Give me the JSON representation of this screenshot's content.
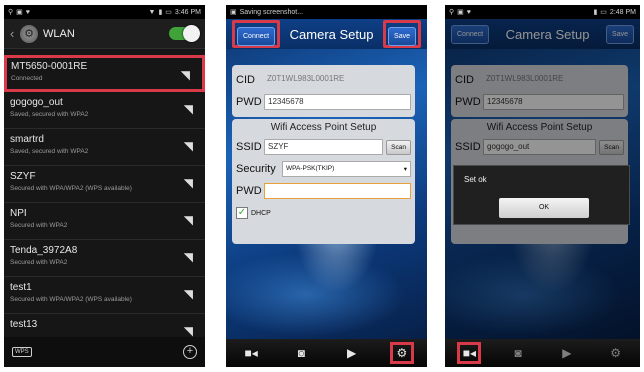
{
  "phone1": {
    "status_time": "3:46 PM",
    "title": "WLAN",
    "networks": [
      {
        "ssid": "MT5650-0001RE",
        "status": "Connected"
      },
      {
        "ssid": "gogogo_out",
        "status": "Saved, secured with WPA2"
      },
      {
        "ssid": "smartrd",
        "status": "Saved, secured with WPA2"
      },
      {
        "ssid": "SZYF",
        "status": "Secured with WPA/WPA2 (WPS available)"
      },
      {
        "ssid": "NPI",
        "status": "Secured with WPA2"
      },
      {
        "ssid": "Tenda_3972A8",
        "status": "Secured with WPA2"
      },
      {
        "ssid": "test1",
        "status": "Secured with WPA/WPA2 (WPS available)"
      },
      {
        "ssid": "test13",
        "status": ""
      }
    ],
    "wps_label": "WPS"
  },
  "phone2": {
    "status_text": "Saving screenshot...",
    "connect_label": "Connect",
    "title": "Camera Setup",
    "save_label": "Save",
    "cid_label": "CID",
    "cid_value": "Z0T1WL983L0001RE",
    "pwd_label": "PWD",
    "pwd_value": "12345678",
    "wifi_title": "Wifi Access Point Setup",
    "ssid_label": "SSID",
    "ssid_value": "SZYF",
    "scan_label": "Scan",
    "security_label": "Security",
    "security_value": "WPA-PSK(TKIP)",
    "wifi_pwd_label": "PWD",
    "dhcp_label": "DHCP"
  },
  "phone3": {
    "status_time": "2:48 PM",
    "connect_label": "Connect",
    "title": "Camera Setup",
    "save_label": "Save",
    "cid_label": "CID",
    "cid_value": "Z0T1WL983L0001RE",
    "pwd_label": "PWD",
    "pwd_value": "12345678",
    "wifi_title": "Wifi Access Point Setup",
    "ssid_label": "SSID",
    "ssid_value": "gogogo_out",
    "scan_label": "Scan",
    "dialog_message": "Set ok",
    "ok_label": "OK"
  },
  "colors": {
    "highlight": "#d93a4a",
    "accent": "#1b63b8",
    "toggle_on": "#3fa33a"
  },
  "icons": [
    "wifi-icon",
    "video-camera-icon",
    "camera-icon",
    "play-icon",
    "gear-icon",
    "plus-icon",
    "back-arrow-icon"
  ]
}
